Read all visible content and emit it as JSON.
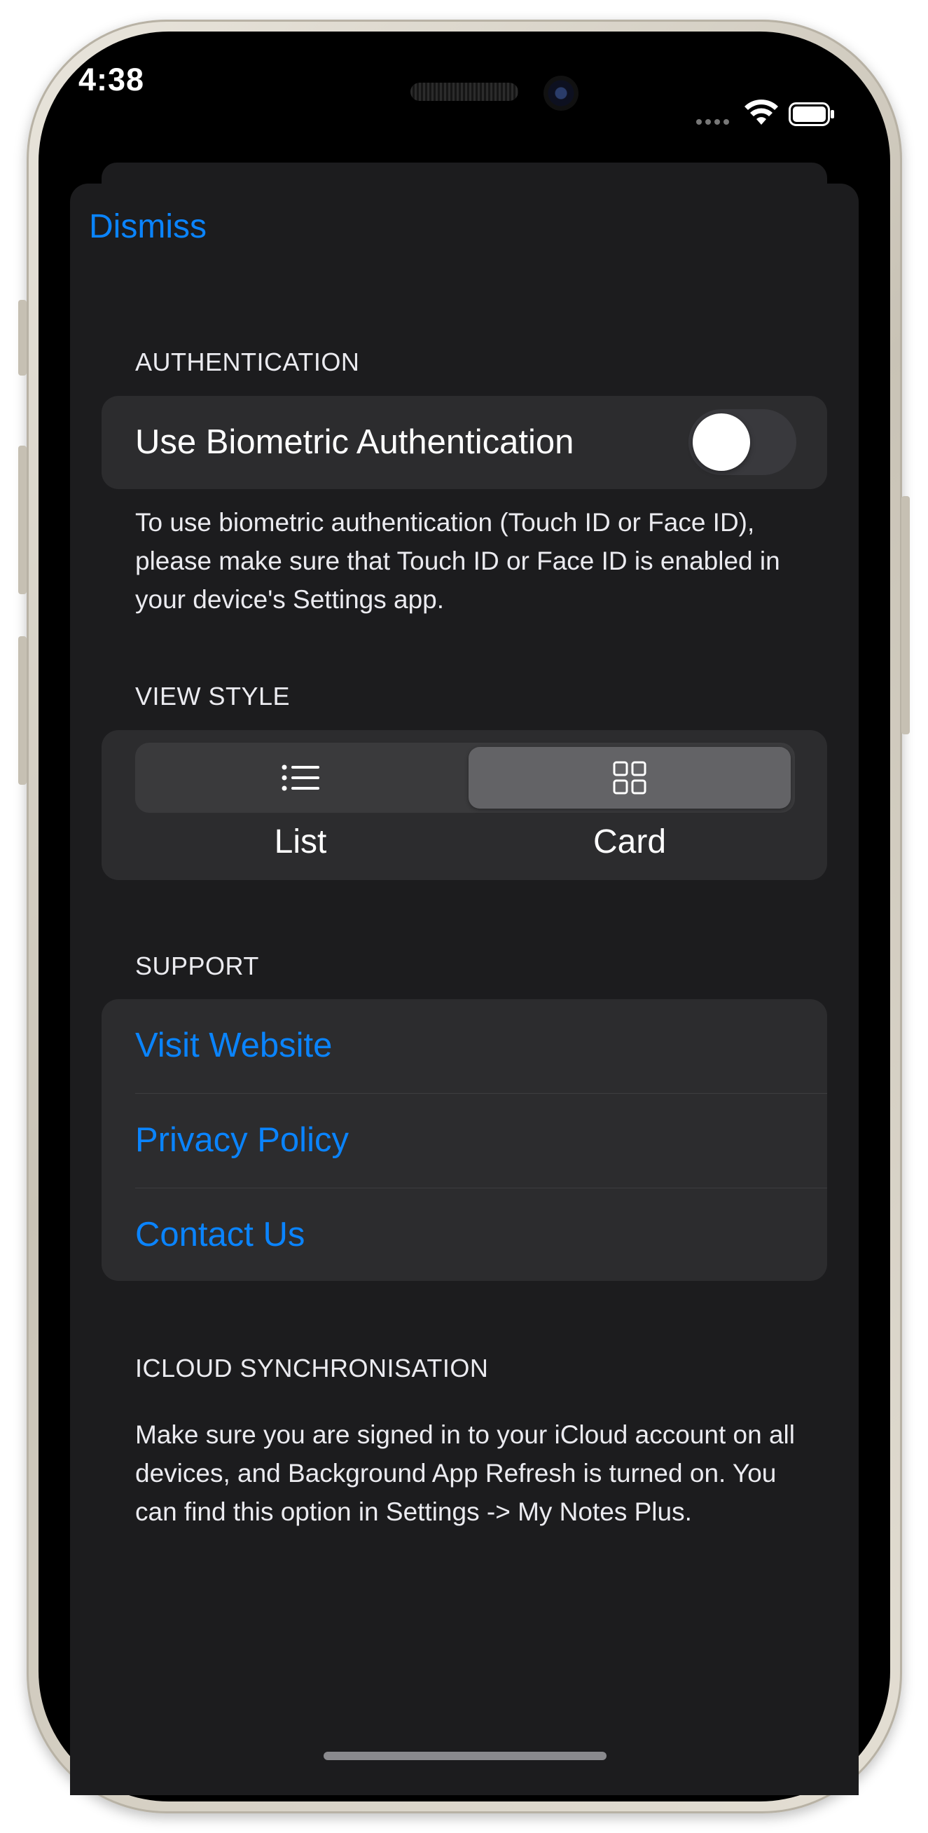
{
  "status_bar": {
    "time": "4:38"
  },
  "nav": {
    "dismiss_label": "Dismiss"
  },
  "authentication": {
    "header": "AUTHENTICATION",
    "biometric_label": "Use Biometric Authentication",
    "biometric_enabled": false,
    "footer": "To use biometric authentication (Touch ID or Face ID), please make sure that Touch ID or Face ID is enabled in your device's Settings app."
  },
  "view_style": {
    "header": "VIEW STYLE",
    "options": [
      {
        "label": "List",
        "icon": "list-icon",
        "selected": false
      },
      {
        "label": "Card",
        "icon": "grid-icon",
        "selected": true
      }
    ]
  },
  "support": {
    "header": "SUPPORT",
    "links": [
      {
        "label": "Visit Website"
      },
      {
        "label": "Privacy Policy"
      },
      {
        "label": "Contact Us"
      }
    ]
  },
  "icloud": {
    "header": "ICLOUD SYNCHRONISATION",
    "text": "Make sure you are signed in to your iCloud account on all devices, and Background App Refresh is turned on. You can find this option in Settings -> My Notes Plus."
  },
  "colors": {
    "accent": "#0a84ff",
    "sheet_background": "#1c1c1e",
    "group_background": "#2c2c2e"
  }
}
